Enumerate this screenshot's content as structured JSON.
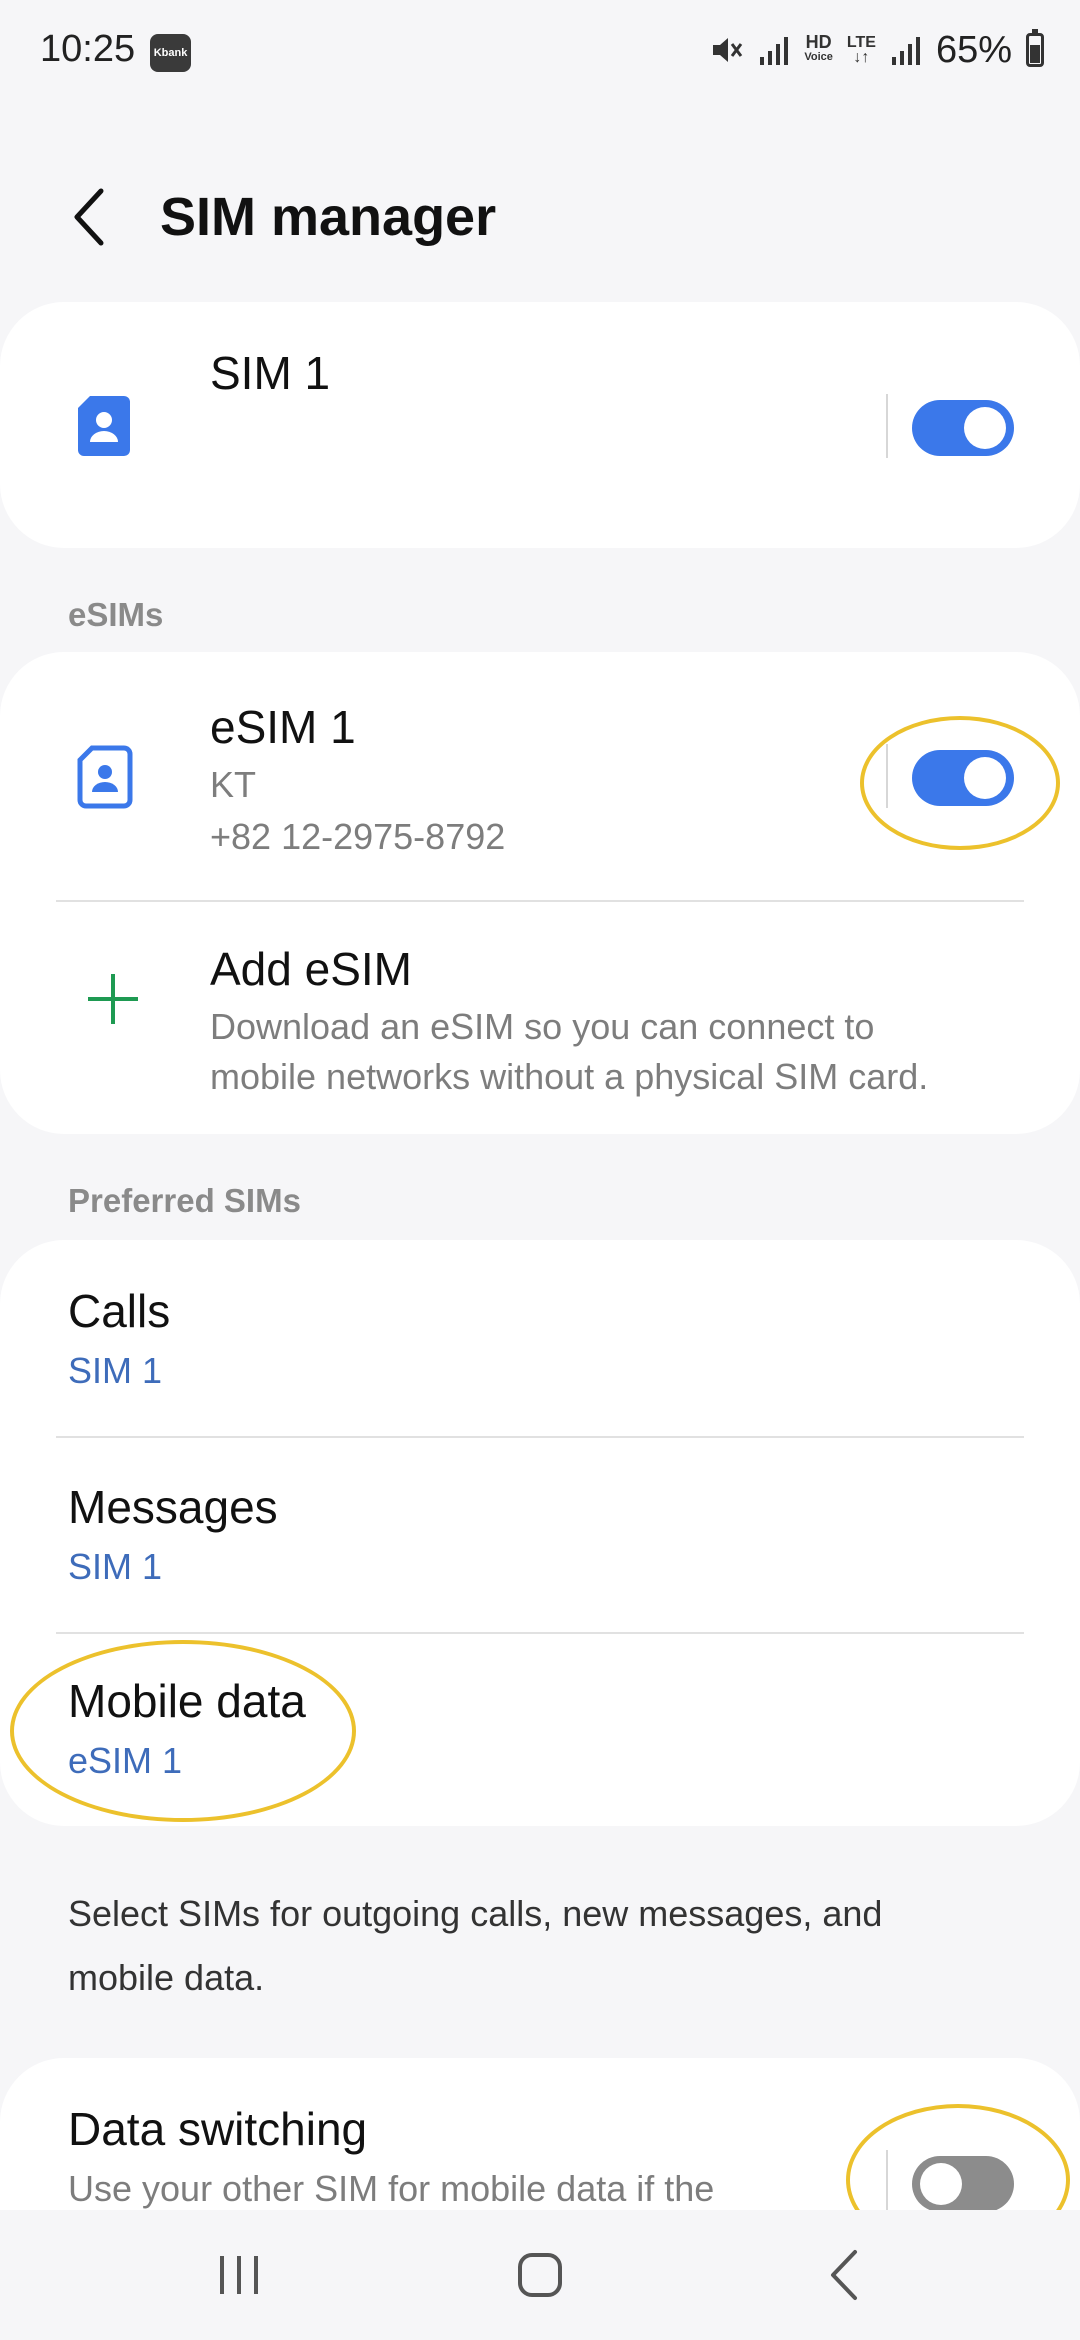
{
  "status_bar": {
    "time": "10:25",
    "kbank_label": "Kbank",
    "hd_top": "HD",
    "hd_bottom": "Voice",
    "lte_label": "LTE",
    "battery_text": "65%"
  },
  "header": {
    "title": "SIM manager"
  },
  "sim1": {
    "title": "SIM 1",
    "enabled": true
  },
  "esims_section": {
    "label": "eSIMs",
    "esim1": {
      "title": "eSIM 1",
      "carrier": "KT",
      "number": "+82 12-2975-8792",
      "enabled": true
    },
    "add_esim": {
      "title": "Add eSIM",
      "description_line1": "Download an eSIM so you can connect to",
      "description_line2": "mobile networks without a physical SIM card."
    }
  },
  "preferred_section": {
    "label": "Preferred SIMs",
    "items": [
      {
        "title": "Calls",
        "value": "SIM 1"
      },
      {
        "title": "Messages",
        "value": "SIM 1"
      },
      {
        "title": "Mobile data",
        "value": "eSIM 1"
      }
    ]
  },
  "info": {
    "line1": "Select SIMs for outgoing calls, new messages, and",
    "line2": "mobile data."
  },
  "data_switching": {
    "title": "Data switching",
    "description": "Use your other SIM for mobile data if the",
    "enabled": false
  },
  "colors": {
    "accent": "#3b78ea",
    "link_blue": "#3e6cba",
    "add_icon_green": "#1e9a52",
    "highlight": "#ecc12c"
  },
  "icons": {
    "back": "chevron-left-icon",
    "sim": "sim-card-icon",
    "esim": "esim-card-icon",
    "add": "plus-icon",
    "nav_recents": "recents-icon",
    "nav_home": "home-icon",
    "nav_back": "back-icon"
  }
}
